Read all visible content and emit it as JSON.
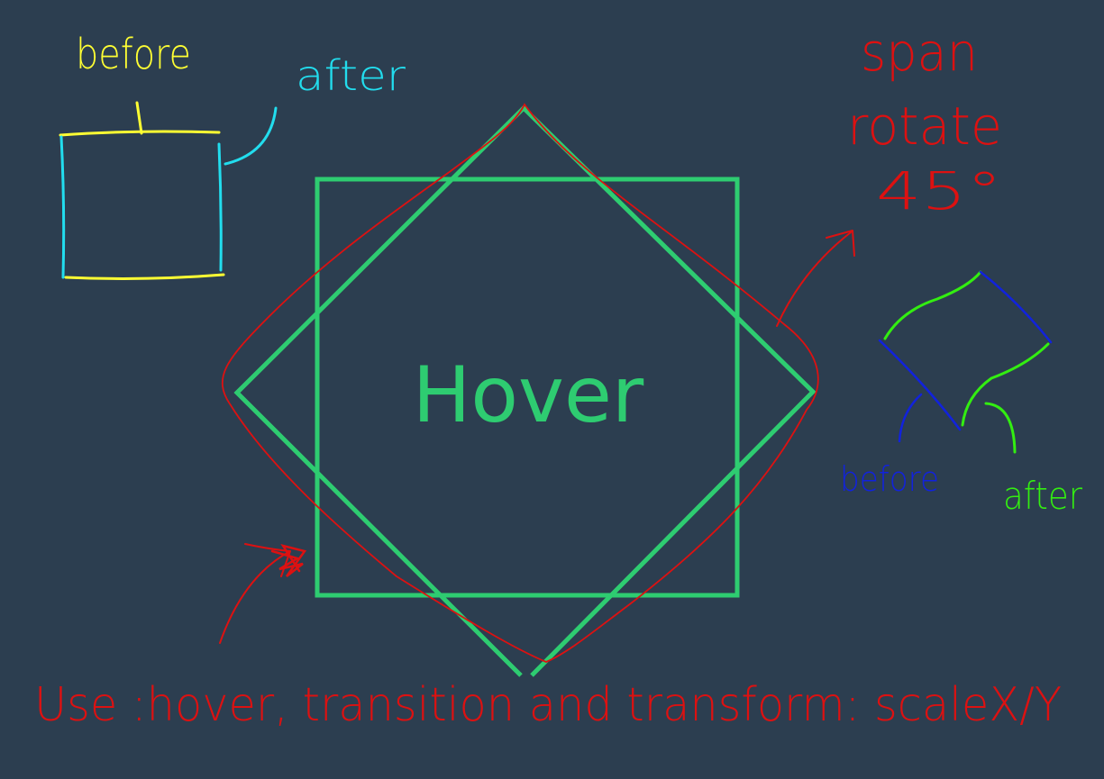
{
  "colors": {
    "background": "#2c3e50",
    "box_green": "#2ecc71",
    "annot_red": "#dd1111",
    "yellow": "#ffff33",
    "cyan": "#22ddee",
    "blue": "#1122dd",
    "bright_green": "#33ee11"
  },
  "box": {
    "label": "Hover"
  },
  "annotations": {
    "left_before": "before",
    "left_after": "after",
    "span_line1": "span",
    "span_line2": "rotate",
    "span_line3": "45°",
    "right_before": "before",
    "right_after": "after",
    "bottom_note": "Use :hover, transition and transform: scaleX/Y"
  }
}
